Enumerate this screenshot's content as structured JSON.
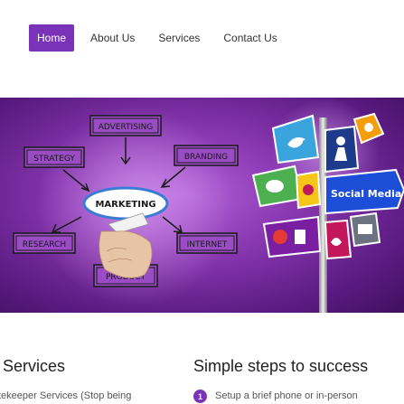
{
  "nav": {
    "items": [
      {
        "label": "Home",
        "active": true
      },
      {
        "label": "About Us",
        "active": false
      },
      {
        "label": "Services",
        "active": false
      },
      {
        "label": "Contact Us",
        "active": false
      }
    ],
    "accent_color": "#7a33b8"
  },
  "hero": {
    "board": {
      "words": [
        "ADVERTISING",
        "STRATEGY",
        "BRANDING",
        "MARKETING",
        "RESEARCH",
        "INTERNET",
        "PRODUCT"
      ]
    },
    "signpost": {
      "main_sign": "Social Media",
      "icons": [
        "twitter-bird-icon",
        "person-icon",
        "rss-icon",
        "chat-bubble-icon",
        "pinterest-icon",
        "facebook-icon",
        "like-icon",
        "heart-icon",
        "mail-icon"
      ]
    }
  },
  "services": {
    "title": "Services",
    "text": "tekeeper Services (Stop being"
  },
  "steps": {
    "title": "Simple steps to success",
    "first_step_number": "1",
    "first_step_text": "Setup a brief phone or in-person"
  }
}
